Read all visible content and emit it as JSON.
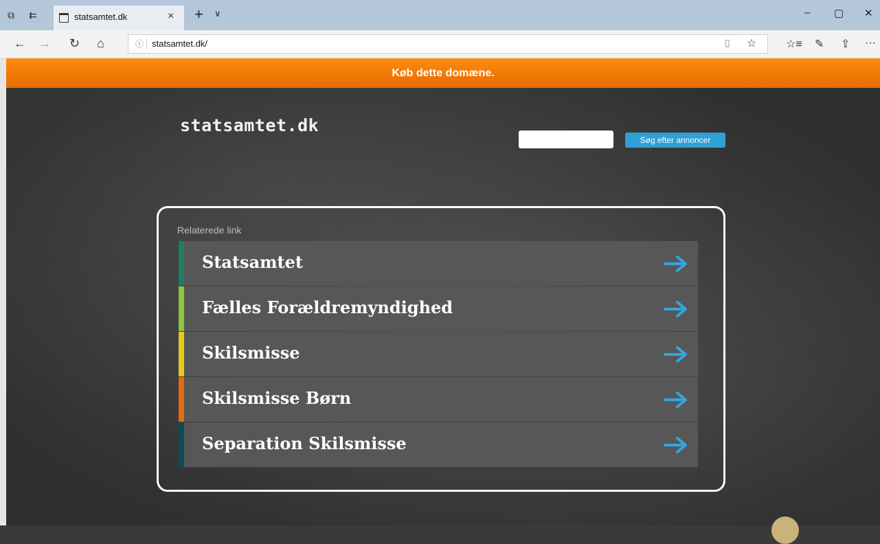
{
  "browser": {
    "tab_title": "statsamtet.dk",
    "tab_close": "×",
    "new_tab": "+",
    "tab_list": "∨",
    "url": "statsamtet.dk/",
    "info_icon": "ⓘ",
    "back": "←",
    "forward": "→",
    "refresh": "↻",
    "home": "⌂",
    "reading_view": "▯",
    "favorite": "☆",
    "favorites_hub": "☆≡",
    "notes": "✎",
    "share": "⇪",
    "more": "···",
    "minimize": "–",
    "restore": "▢",
    "close_window": "✕"
  },
  "promo": {
    "text": "Køb dette domæne."
  },
  "site": {
    "title": "statsamtet.dk"
  },
  "search": {
    "value": "",
    "button": "Søg efter annoncer"
  },
  "related": {
    "label": "Relaterede link",
    "items": [
      {
        "label": "Statsamtet",
        "color": "#1f7d63"
      },
      {
        "label": "Fælles Forældremyndighed",
        "color": "#8ec63f"
      },
      {
        "label": "Skilsmisse",
        "color": "#e7c91b"
      },
      {
        "label": "Skilsmisse Børn",
        "color": "#e56a10"
      },
      {
        "label": "Separation Skilsmisse",
        "color": "#0d4a5e"
      }
    ],
    "arrow_color": "#31a6de"
  }
}
